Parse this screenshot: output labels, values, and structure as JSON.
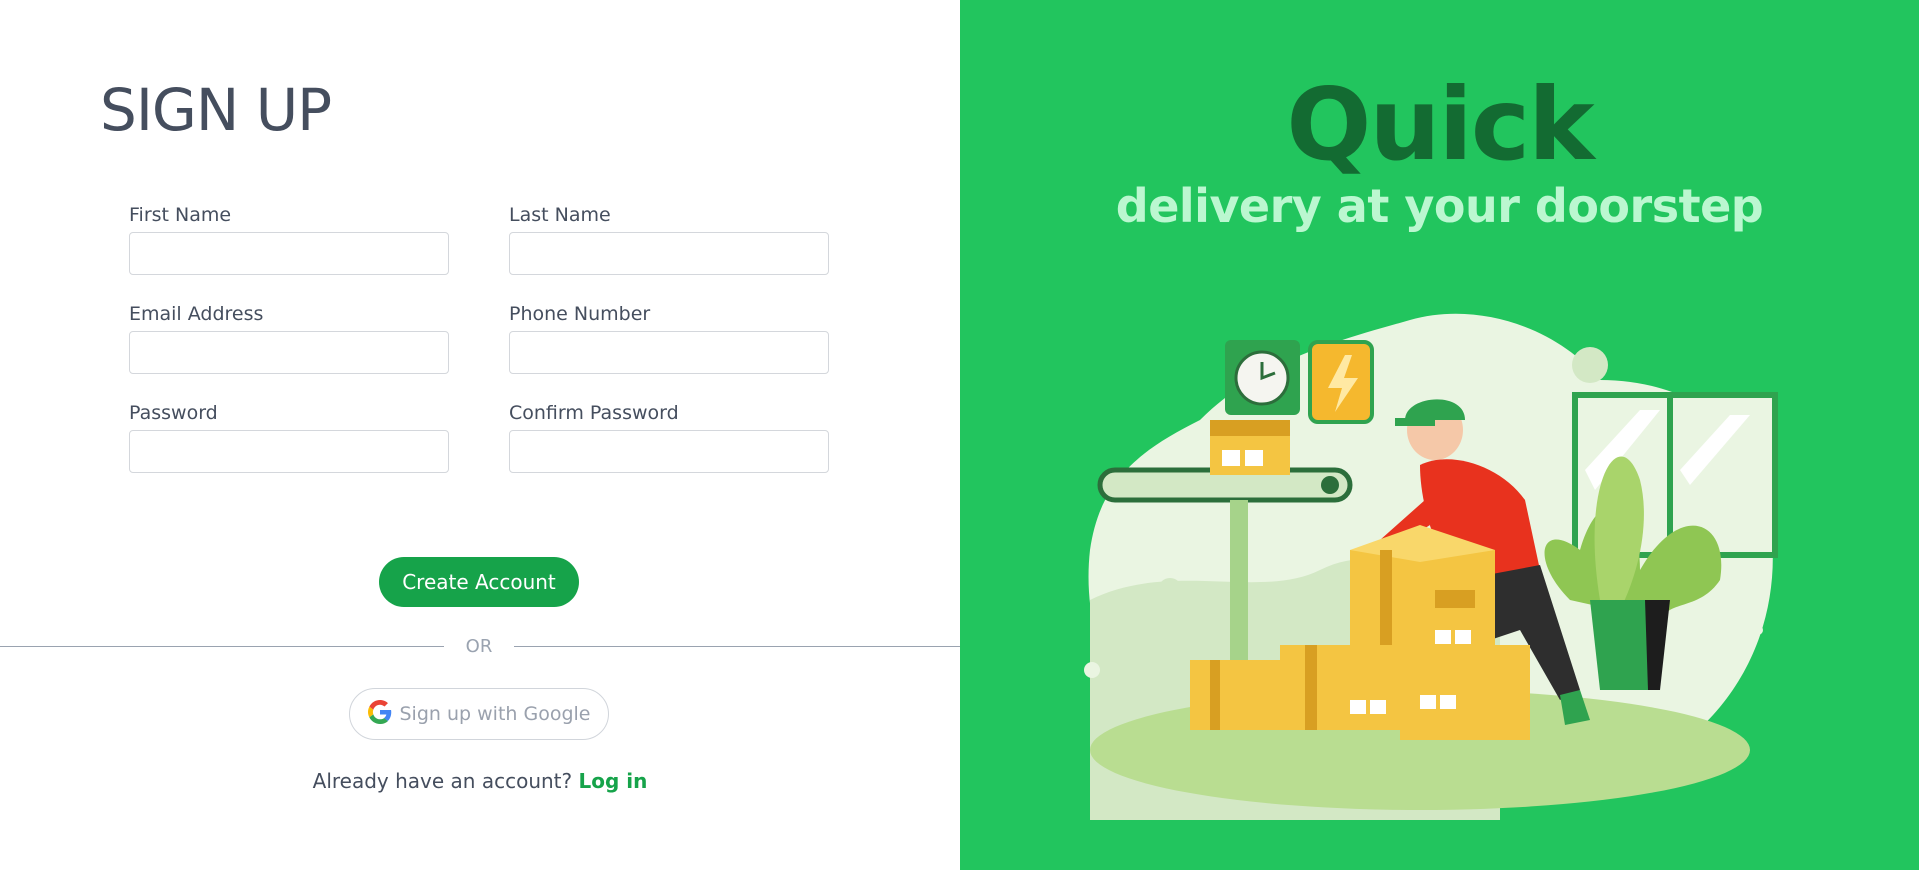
{
  "form": {
    "title": "SIGN UP",
    "fields": [
      {
        "label": "First Name",
        "value": ""
      },
      {
        "label": "Last Name",
        "value": ""
      },
      {
        "label": "Email Address",
        "value": ""
      },
      {
        "label": "Phone Number",
        "value": ""
      },
      {
        "label": "Password",
        "value": ""
      },
      {
        "label": "Confirm Password",
        "value": ""
      }
    ],
    "submit_label": "Create Account",
    "divider_text": "OR",
    "google_label": "Sign up with Google",
    "login_prompt": "Already have an account?",
    "login_link": "Log in"
  },
  "hero": {
    "title": "Quick",
    "subtitle": "delivery at your doorstep"
  },
  "colors": {
    "accent": "#16a34a",
    "hero_bg": "#22c55e",
    "hero_title": "#136b32",
    "hero_subtitle": "#bbf7d0",
    "text": "#454e5e"
  },
  "icons": {
    "google": "google-logo-icon",
    "illustration": "delivery-person-packages-illustration"
  }
}
